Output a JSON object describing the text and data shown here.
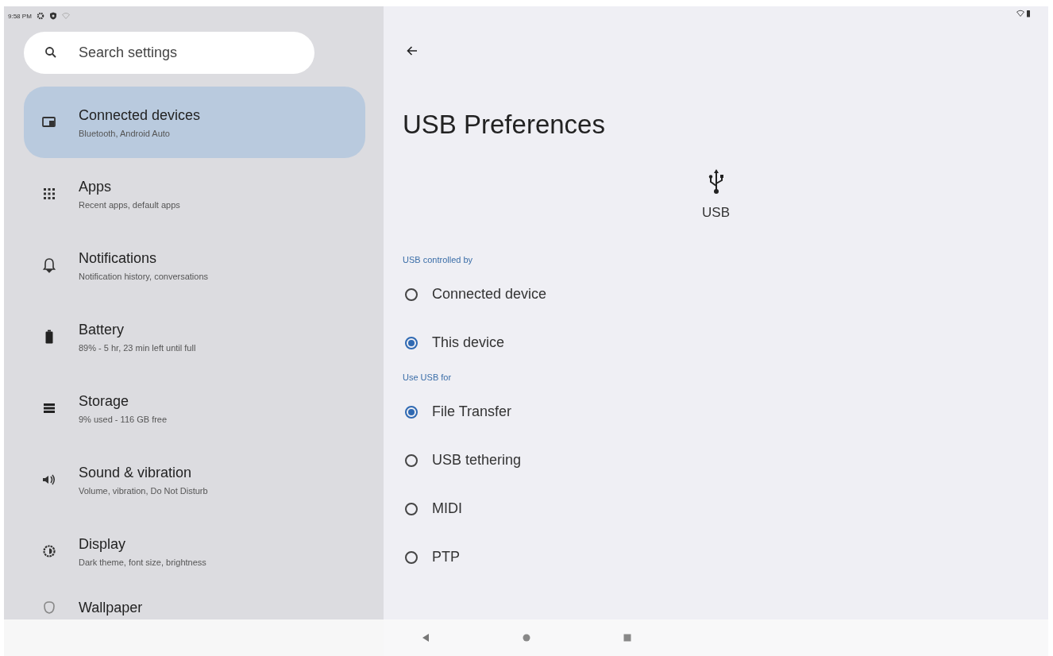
{
  "status_bar": {
    "time": "9:58 PM"
  },
  "search": {
    "placeholder": "Search settings"
  },
  "sidebar": {
    "items": [
      {
        "title": "Connected devices",
        "subtitle": "Bluetooth, Android Auto",
        "selected": true
      },
      {
        "title": "Apps",
        "subtitle": "Recent apps, default apps",
        "selected": false
      },
      {
        "title": "Notifications",
        "subtitle": "Notification history, conversations",
        "selected": false
      },
      {
        "title": "Battery",
        "subtitle": "89% - 5 hr, 23 min left until full",
        "selected": false
      },
      {
        "title": "Storage",
        "subtitle": "9% used - 116 GB free",
        "selected": false
      },
      {
        "title": "Sound & vibration",
        "subtitle": "Volume, vibration, Do Not Disturb",
        "selected": false
      },
      {
        "title": "Display",
        "subtitle": "Dark theme, font size, brightness",
        "selected": false
      },
      {
        "title": "Wallpaper",
        "selected": false
      }
    ]
  },
  "detail": {
    "title": "USB Preferences",
    "header_label": "USB",
    "sections": [
      {
        "heading": "USB controlled by",
        "options": [
          {
            "label": "Connected device",
            "selected": false
          },
          {
            "label": "This device",
            "selected": true
          }
        ]
      },
      {
        "heading": "Use USB for",
        "options": [
          {
            "label": "File Transfer",
            "selected": true
          },
          {
            "label": "USB tethering",
            "selected": false
          },
          {
            "label": "MIDI",
            "selected": false
          },
          {
            "label": "PTP",
            "selected": false
          }
        ]
      }
    ]
  }
}
